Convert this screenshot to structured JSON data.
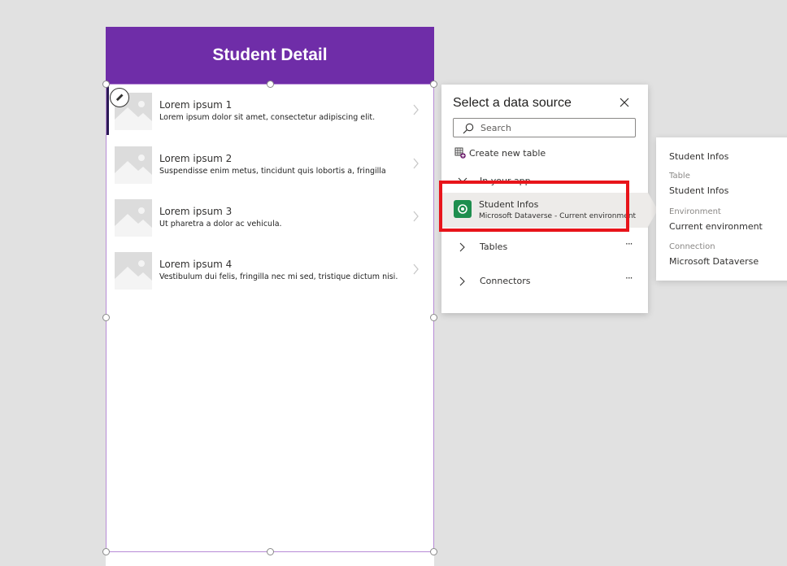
{
  "screen": {
    "header_title": "Student Detail",
    "gallery_items": [
      {
        "title": "Lorem ipsum 1",
        "subtitle": "Lorem ipsum dolor sit amet, consectetur adipiscing elit."
      },
      {
        "title": "Lorem ipsum 2",
        "subtitle": "Suspendisse enim metus, tincidunt quis lobortis a, fringilla"
      },
      {
        "title": "Lorem ipsum 3",
        "subtitle": "Ut pharetra a dolor ac vehicula."
      },
      {
        "title": "Lorem ipsum 4",
        "subtitle": "Vestibulum dui felis, fringilla nec mi sed, tristique dictum nisi."
      }
    ]
  },
  "data_source_panel": {
    "title": "Select a data source",
    "search_placeholder": "Search",
    "create_new_table_label": "Create new table",
    "in_your_app_label": "In your app",
    "selected_option": {
      "title": "Student Infos",
      "subtitle": "Microsoft Dataverse - Current environment"
    },
    "nav_items": [
      {
        "label": "Tables",
        "more": "···"
      },
      {
        "label": "Connectors",
        "more": "···"
      }
    ]
  },
  "info_callout": {
    "title": "Student Infos",
    "table_label": "Table",
    "table_value": "Student Infos",
    "environment_label": "Environment",
    "environment_value": "Current environment",
    "connection_label": "Connection",
    "connection_value": "Microsoft Dataverse"
  },
  "colors": {
    "header": "#6f2da8",
    "highlight": "#e8141a",
    "dataverse_icon": "#1e8e4e",
    "canvas_background": "#e1e1e1"
  },
  "icons": {
    "edit": "pencil-icon",
    "search": "search-icon",
    "close": "close-icon",
    "table": "table-add-icon",
    "dataverse": "dataverse-icon",
    "chevron": "chevron-right-icon"
  }
}
